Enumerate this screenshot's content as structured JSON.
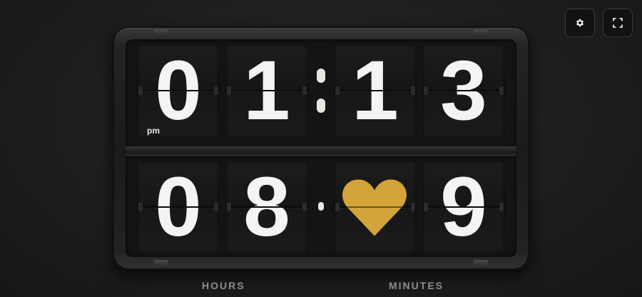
{
  "toolbar": {
    "settings_icon": "gear-icon",
    "fullscreen_icon": "fullscreen-icon"
  },
  "clock": {
    "time": {
      "hour_tens": "0",
      "hour_ones": "1",
      "minute_tens": "1",
      "minute_ones": "3",
      "period": "pm"
    },
    "date": {
      "month_tens": "0",
      "month_ones": "8",
      "day_tens_icon": "heart-icon",
      "day_ones": "9"
    },
    "labels": {
      "hours": "HOURS",
      "minutes": "MINUTES"
    },
    "colors": {
      "digit": "#f4f4f4",
      "heart": "#d3a43a",
      "background": "#1f1f1f"
    }
  }
}
